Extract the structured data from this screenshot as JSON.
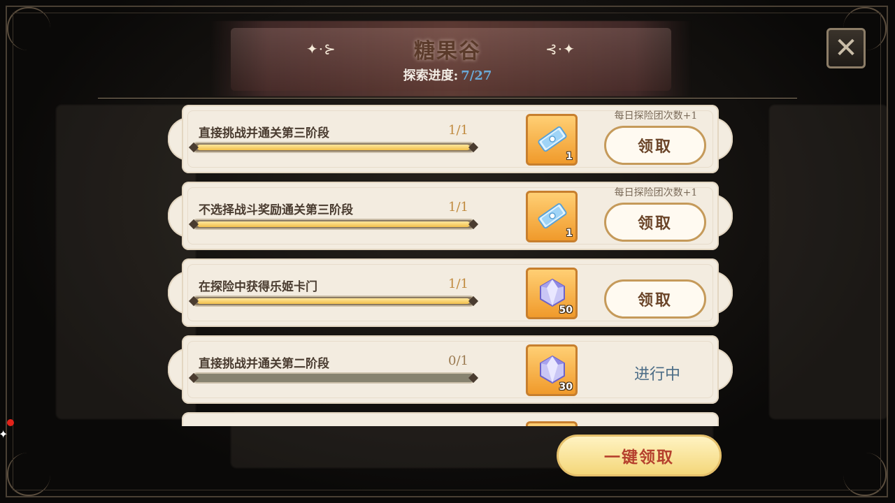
{
  "header": {
    "title": "糖果谷",
    "flourish_left": "✦·⊱",
    "flourish_right": "⊰·✦",
    "progress_label": "探索进度:",
    "progress_value": "7/27"
  },
  "close_icon": "close-icon",
  "tasks": [
    {
      "label": "直接挑战并通关第三阶段",
      "count": "1/1",
      "progress": 1.0,
      "reward_icon": "ticket-icon",
      "reward_qty": "1",
      "bonus": "每日探险团次数+1",
      "action": "领取",
      "state": "claimable"
    },
    {
      "label": "不选择战斗奖励通关第三阶段",
      "count": "1/1",
      "progress": 1.0,
      "reward_icon": "ticket-icon",
      "reward_qty": "1",
      "bonus": "每日探险团次数+1",
      "action": "领取",
      "state": "claimable"
    },
    {
      "label": "在探险中获得乐姬卡门",
      "count": "1/1",
      "progress": 1.0,
      "reward_icon": "diamond-icon",
      "reward_qty": "50",
      "bonus": "",
      "action": "领取",
      "state": "claimable"
    },
    {
      "label": "直接挑战并通关第二阶段",
      "count": "0/1",
      "progress": 0.0,
      "reward_icon": "diamond-icon",
      "reward_qty": "30",
      "bonus": "",
      "action": "进行中",
      "state": "in-progress"
    }
  ],
  "claim_all_label": "一键领取",
  "colors": {
    "accent": "#f2c04c",
    "status": "#4b6c86",
    "claim_all_text": "#b5402d"
  }
}
